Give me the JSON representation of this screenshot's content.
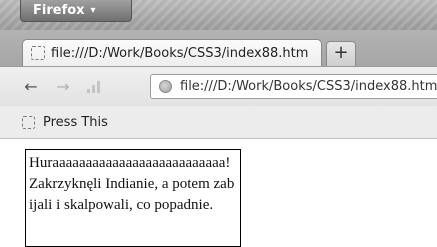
{
  "browser": {
    "menu_button_label": "Firefox",
    "menu_arrow": "▾",
    "tab_title": "file:///D:/Work/Books/CSS3/index88.htm",
    "new_tab_label": "+",
    "back_icon": "←",
    "forward_icon": "→",
    "url": "file:///D:/Work/Books/CSS3/index88.htm",
    "bookmarks": [
      {
        "label": "Press This"
      }
    ]
  },
  "content": {
    "text": "Huraaaaaaaaaaaaaaaaaaaaaaaaaa! Zakrzyknęli Indianie, a potem zabijali i skalpowali, co popadnie."
  }
}
